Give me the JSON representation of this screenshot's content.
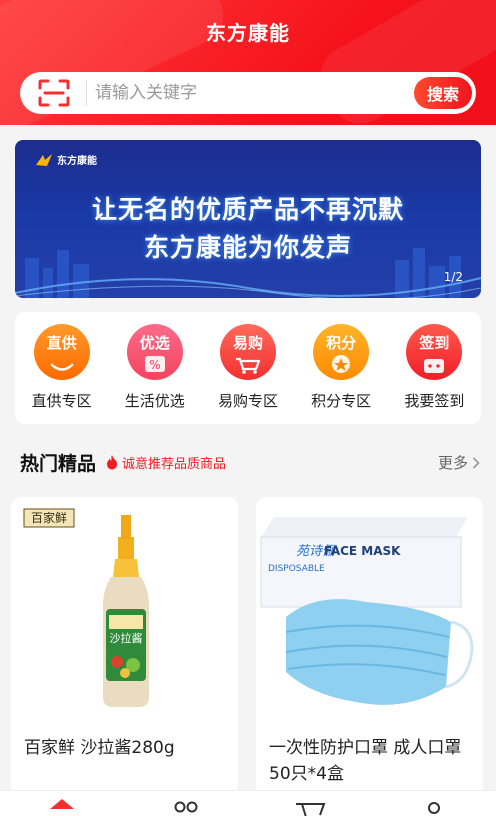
{
  "header": {
    "title": "东方康能",
    "search_placeholder": "请输入关键字",
    "search_button": "搜索",
    "scan_icon": "scan-icon"
  },
  "banner": {
    "logo_text": "东方康能",
    "line1": "让无名的优质产品不再沉默",
    "line2": "东方康能为你发声",
    "page_indicator": "1/2"
  },
  "categories": [
    {
      "icon_label": "直供",
      "label": "直供专区",
      "color": "#ff7a10"
    },
    {
      "icon_label": "优选",
      "label": "生活优选",
      "color": "#f2455e"
    },
    {
      "icon_label": "易购",
      "label": "易购专区",
      "color": "#f23030"
    },
    {
      "icon_label": "积分",
      "label": "积分专区",
      "color": "#ff8a00"
    },
    {
      "icon_label": "签到",
      "label": "我要签到",
      "color": "#f01e2a"
    }
  ],
  "hot": {
    "title": "热门精品",
    "subtitle": "诚意推荐品质商品",
    "more": "更多"
  },
  "products": [
    {
      "name": "百家鲜 沙拉酱280g",
      "brand": "百家鲜",
      "bottle_label": "沙拉酱"
    },
    {
      "name": "一次性防护口罩 成人口罩50只*4盒",
      "box_text": "FACE MASK",
      "box_sub": "DISPOSABLE"
    }
  ],
  "tabbar": [
    "home-icon",
    "category-icon",
    "cart-icon",
    "profile-icon"
  ],
  "colors": {
    "brand_red": "#f5121b",
    "accent_orange": "#ff6a00"
  }
}
